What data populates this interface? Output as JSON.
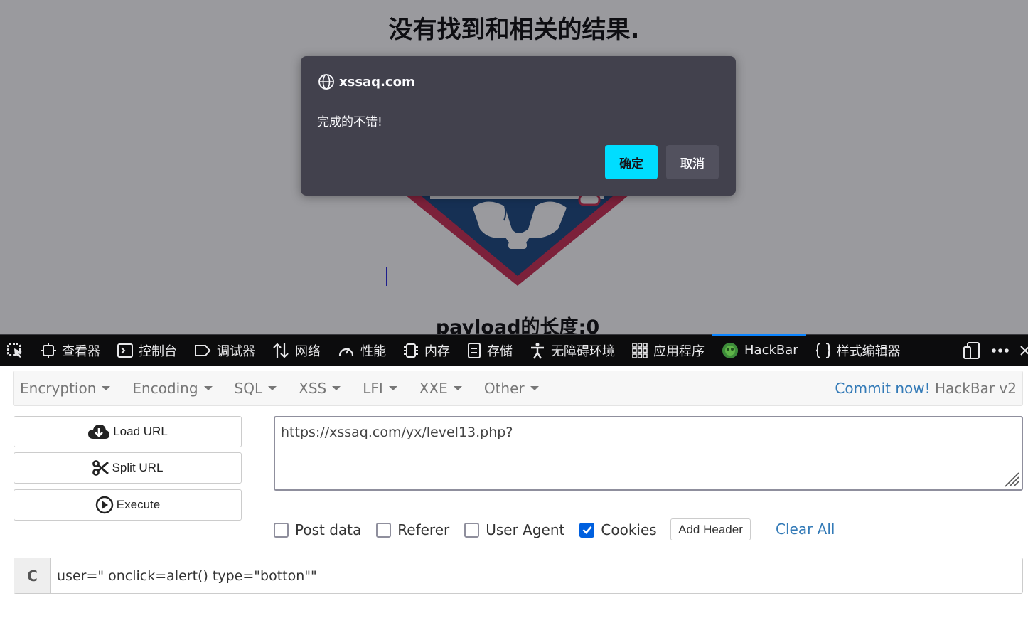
{
  "page": {
    "title": "没有找到和相关的结果.",
    "payload_length": "payload的长度:0"
  },
  "alert": {
    "site": "xssaq.com",
    "message": "完成的不错!",
    "ok_label": "确定",
    "cancel_label": "取消",
    "accent_color": "#00ddff"
  },
  "devtools": {
    "tabs": [
      {
        "label": "查看器",
        "icon": "inspector-icon"
      },
      {
        "label": "控制台",
        "icon": "console-icon"
      },
      {
        "label": "调试器",
        "icon": "debugger-icon"
      },
      {
        "label": "网络",
        "icon": "network-icon"
      },
      {
        "label": "性能",
        "icon": "performance-icon"
      },
      {
        "label": "内存",
        "icon": "memory-icon"
      },
      {
        "label": "存储",
        "icon": "storage-icon"
      },
      {
        "label": "无障碍环境",
        "icon": "accessibility-icon"
      },
      {
        "label": "应用程序",
        "icon": "application-icon"
      },
      {
        "label": "HackBar",
        "icon": "hackbar-icon",
        "active": true
      },
      {
        "label": "样式编辑器",
        "icon": "style-editor-icon"
      }
    ]
  },
  "hackbar": {
    "menu": [
      "Encryption",
      "Encoding",
      "SQL",
      "XSS",
      "LFI",
      "XXE",
      "Other"
    ],
    "commit_link": "Commit now!",
    "brand": "HackBar v2",
    "load_url_label": "Load URL",
    "split_url_label": "Split URL",
    "execute_label": "Execute",
    "url_value": "https://xssaq.com/yx/level13.php?",
    "options": {
      "post_data": {
        "label": "Post data",
        "checked": false
      },
      "referer": {
        "label": "Referer",
        "checked": false
      },
      "user_agent": {
        "label": "User Agent",
        "checked": false
      },
      "cookies": {
        "label": "Cookies",
        "checked": true
      }
    },
    "add_header_label": "Add Header",
    "clear_all_label": "Clear All",
    "cookie_row_label": "C",
    "cookie_value": "user=\" onclick=alert() type=\"botton\"\""
  }
}
